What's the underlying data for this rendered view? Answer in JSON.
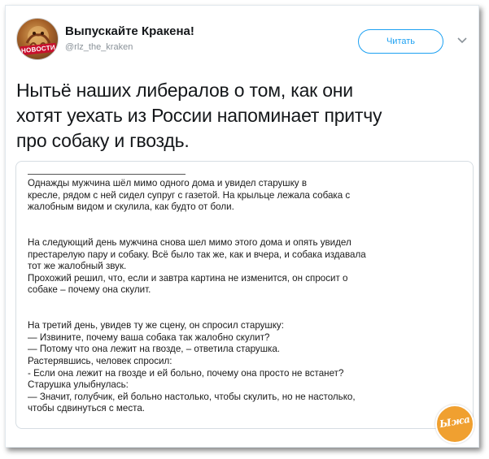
{
  "tweet": {
    "author_name": "Выпускайте Кракена!",
    "author_handle": "@rlz_the_kraken",
    "avatar_badge": "НОВОСТИ",
    "follow_label": "Читать",
    "text_lines": [
      "Нытьё наших либералов о том, как они",
      "хотят уехать из России напоминает притчу",
      "про собаку и гвоздь."
    ]
  },
  "story": {
    "paragraph1": [
      "Однажды мужчина шёл мимо одного дома и увидел старушку в",
      "кресле, рядом с ней сидел супруг с газетой. На крыльце лежала собака с",
      "жалобным видом и скулила, как будто от боли."
    ],
    "paragraph2": [
      "На следующий день мужчина снова шел мимо этого дома и опять увидел",
      "престарелую пару и собаку. Всё было так же, как и вчера, и собака издавала",
      "тот же жалобный звук.",
      "Прохожий решил, что, если и завтра картина не изменится, он спросит о",
      "собаке – почему она скулит."
    ],
    "paragraph3": [
      "На третий день, увидев ту же сцену, он спросил старушку:",
      "— Извините, почему ваша собака так жалобно скулит?",
      "— Потому что она лежит на гвозде, – ответила старушка.",
      "Растерявшись, человек спросил:",
      "- Если она лежит на гвозде и ей больно, почему она просто не встанет?",
      "Старушка улыбнулась:",
      "— Значит, голубчик, ей больно настолько, чтобы скулить, но не настолько,",
      "чтобы сдвинуться с места."
    ]
  },
  "watermark": {
    "logo_text": "Ыжа"
  },
  "colors": {
    "accent": "#1da1f2",
    "text": "#14171a",
    "muted": "#8a9299",
    "logo": "#f0a030"
  },
  "icons": {
    "menu": "chevron-down-icon"
  }
}
